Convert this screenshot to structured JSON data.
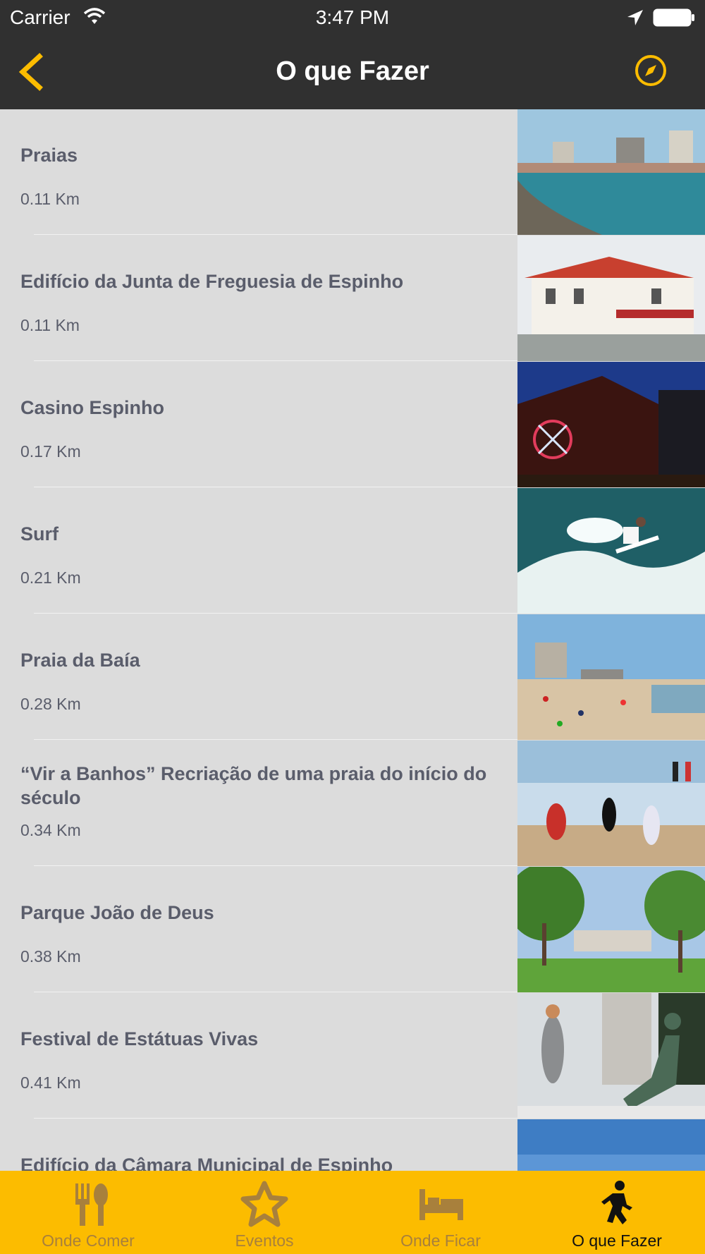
{
  "status_bar": {
    "carrier": "Carrier",
    "time": "3:47 PM"
  },
  "nav": {
    "title": "O que Fazer",
    "back_icon": "chevron-left-icon",
    "right_icon": "compass-icon",
    "accent": "#fcbc00"
  },
  "items": [
    {
      "name": "Praias",
      "distance": "0.11 Km",
      "thumb": "harbor-beach-photo"
    },
    {
      "name": "Edifício da Junta de Freguesia de Espinho",
      "distance": "0.11 Km",
      "thumb": "white-building-red-roof-photo"
    },
    {
      "name": "Casino Espinho",
      "distance": "0.17 Km",
      "thumb": "casino-night-photo"
    },
    {
      "name": "Surf",
      "distance": "0.21 Km",
      "thumb": "surfer-wave-photo"
    },
    {
      "name": "Praia da Baía",
      "distance": "0.28 Km",
      "thumb": "crowded-beach-photo"
    },
    {
      "name": "“Vir a Banhos” Recriação de uma praia do início do século",
      "distance": "0.34 Km",
      "thumb": "people-shore-photo"
    },
    {
      "name": "Parque João de Deus",
      "distance": "0.38 Km",
      "thumb": "park-trees-photo"
    },
    {
      "name": "Festival de Estátuas Vivas",
      "distance": "0.41 Km",
      "thumb": "living-statue-photo"
    },
    {
      "name": "Edifício da Câmara Municipal de Espinho",
      "distance": "",
      "thumb": "sky-photo"
    }
  ],
  "tabs": [
    {
      "label": "Onde Comer",
      "icon": "fork-spoon-icon",
      "active": false
    },
    {
      "label": "Eventos",
      "icon": "star-icon",
      "active": false
    },
    {
      "label": "Onde Ficar",
      "icon": "bed-icon",
      "active": false
    },
    {
      "label": "O que Fazer",
      "icon": "walking-person-icon",
      "active": true
    }
  ]
}
